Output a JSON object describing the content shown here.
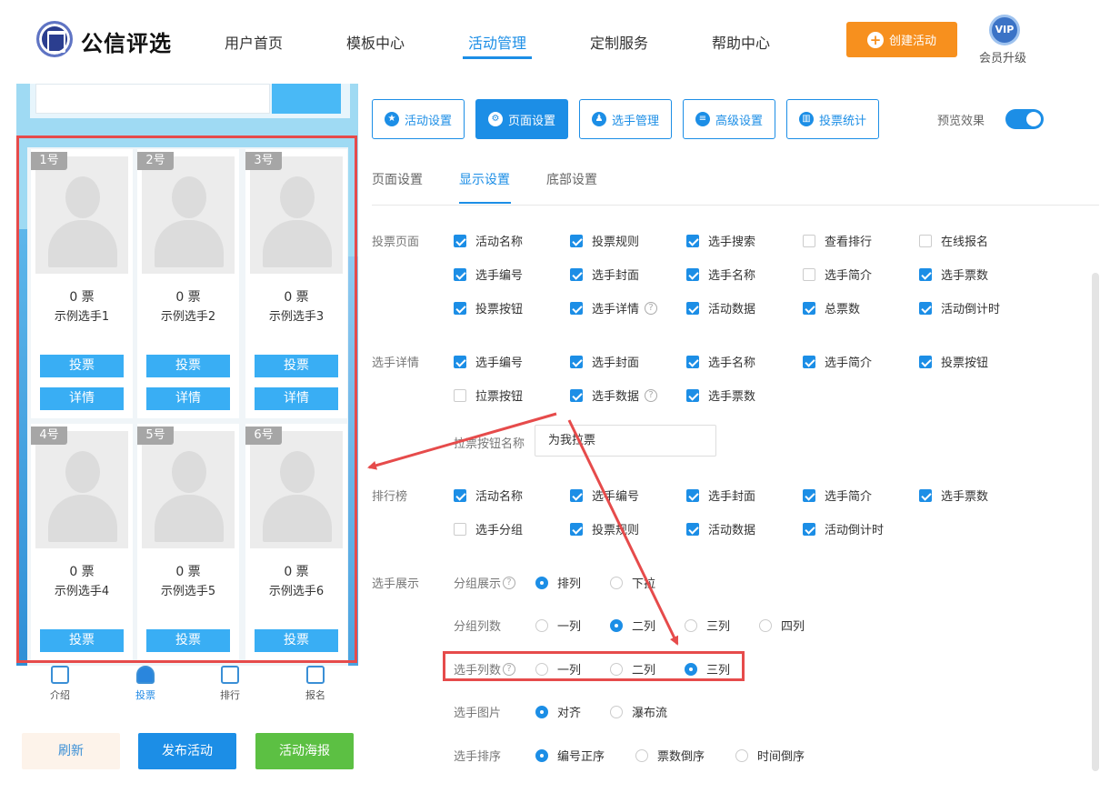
{
  "brand": {
    "name": "公信评选"
  },
  "nav": {
    "items": [
      "用户首页",
      "模板中心",
      "活动管理",
      "定制服务",
      "帮助中心"
    ],
    "active": "活动管理"
  },
  "create_button": "创建活动",
  "vip": {
    "badge": "VIP",
    "label": "会员升级"
  },
  "toolbar": {
    "tabs": [
      "活动设置",
      "页面设置",
      "选手管理",
      "高级设置",
      "投票统计"
    ],
    "active": "页面设置",
    "preview_label": "预览效果",
    "preview_on": true
  },
  "subtabs": {
    "items": [
      "页面设置",
      "显示设置",
      "底部设置"
    ],
    "active": "显示设置"
  },
  "preview": {
    "cards": [
      {
        "num": "1号",
        "votes": "0 票",
        "name": "示例选手1",
        "vote_label": "投票",
        "detail_label": "详情"
      },
      {
        "num": "2号",
        "votes": "0 票",
        "name": "示例选手2",
        "vote_label": "投票",
        "detail_label": "详情"
      },
      {
        "num": "3号",
        "votes": "0 票",
        "name": "示例选手3",
        "vote_label": "投票",
        "detail_label": "详情"
      },
      {
        "num": "4号",
        "votes": "0 票",
        "name": "示例选手4",
        "vote_label": "投票"
      },
      {
        "num": "5号",
        "votes": "0 票",
        "name": "示例选手5",
        "vote_label": "投票"
      },
      {
        "num": "6号",
        "votes": "0 票",
        "name": "示例选手6",
        "vote_label": "投票"
      }
    ],
    "tabs": [
      "介绍",
      "投票",
      "排行",
      "报名"
    ],
    "active_tab": "投票",
    "buttons": {
      "refresh": "刷新",
      "publish": "发布活动",
      "poster": "活动海报"
    }
  },
  "settings": {
    "vote_page": {
      "label": "投票页面",
      "options": [
        {
          "label": "活动名称",
          "checked": true
        },
        {
          "label": "投票规则",
          "checked": true
        },
        {
          "label": "选手搜索",
          "checked": true
        },
        {
          "label": "查看排行",
          "checked": false
        },
        {
          "label": "在线报名",
          "checked": false
        },
        {
          "label": "选手编号",
          "checked": true
        },
        {
          "label": "选手封面",
          "checked": true
        },
        {
          "label": "选手名称",
          "checked": true
        },
        {
          "label": "选手简介",
          "checked": false
        },
        {
          "label": "选手票数",
          "checked": true
        },
        {
          "label": "投票按钮",
          "checked": true
        },
        {
          "label": "选手详情",
          "checked": true
        },
        {
          "label": "活动数据",
          "checked": true
        },
        {
          "label": "总票数",
          "checked": true
        },
        {
          "label": "活动倒计时",
          "checked": true
        }
      ]
    },
    "detail": {
      "label": "选手详情",
      "options": [
        {
          "label": "选手编号",
          "checked": true
        },
        {
          "label": "选手封面",
          "checked": true
        },
        {
          "label": "选手名称",
          "checked": true
        },
        {
          "label": "选手简介",
          "checked": true
        },
        {
          "label": "投票按钮",
          "checked": true
        },
        {
          "label": "拉票按钮",
          "checked": false
        },
        {
          "label": "选手数据",
          "checked": true
        },
        {
          "label": "选手票数",
          "checked": true
        }
      ],
      "canvass_label": "拉票按钮名称",
      "canvass_value": "为我拉票"
    },
    "ranking": {
      "label": "排行榜",
      "options": [
        {
          "label": "活动名称",
          "checked": true
        },
        {
          "label": "选手编号",
          "checked": true
        },
        {
          "label": "选手封面",
          "checked": true
        },
        {
          "label": "选手简介",
          "checked": true
        },
        {
          "label": "选手票数",
          "checked": true
        },
        {
          "label": "选手分组",
          "checked": false
        },
        {
          "label": "投票规则",
          "checked": true
        },
        {
          "label": "活动数据",
          "checked": true
        },
        {
          "label": "活动倒计时",
          "checked": true
        }
      ]
    },
    "display": {
      "label": "选手展示",
      "group_display": {
        "label": "分组展示",
        "options": [
          "排列",
          "下拉"
        ],
        "selected": "排列"
      },
      "group_columns": {
        "label": "分组列数",
        "options": [
          "一列",
          "二列",
          "三列",
          "四列"
        ],
        "selected": "二列"
      },
      "player_columns": {
        "label": "选手列数",
        "options": [
          "一列",
          "二列",
          "三列"
        ],
        "selected": "三列"
      },
      "player_image": {
        "label": "选手图片",
        "options": [
          "对齐",
          "瀑布流"
        ],
        "selected": "对齐"
      },
      "player_sort": {
        "label": "选手排序",
        "options": [
          "编号正序",
          "票数倒序",
          "时间倒序"
        ],
        "selected": "编号正序"
      }
    }
  },
  "colors": {
    "accent": "#1c8ee6",
    "orange": "#f7901e",
    "highlight": "#e64b4b",
    "green": "#5cc043"
  }
}
